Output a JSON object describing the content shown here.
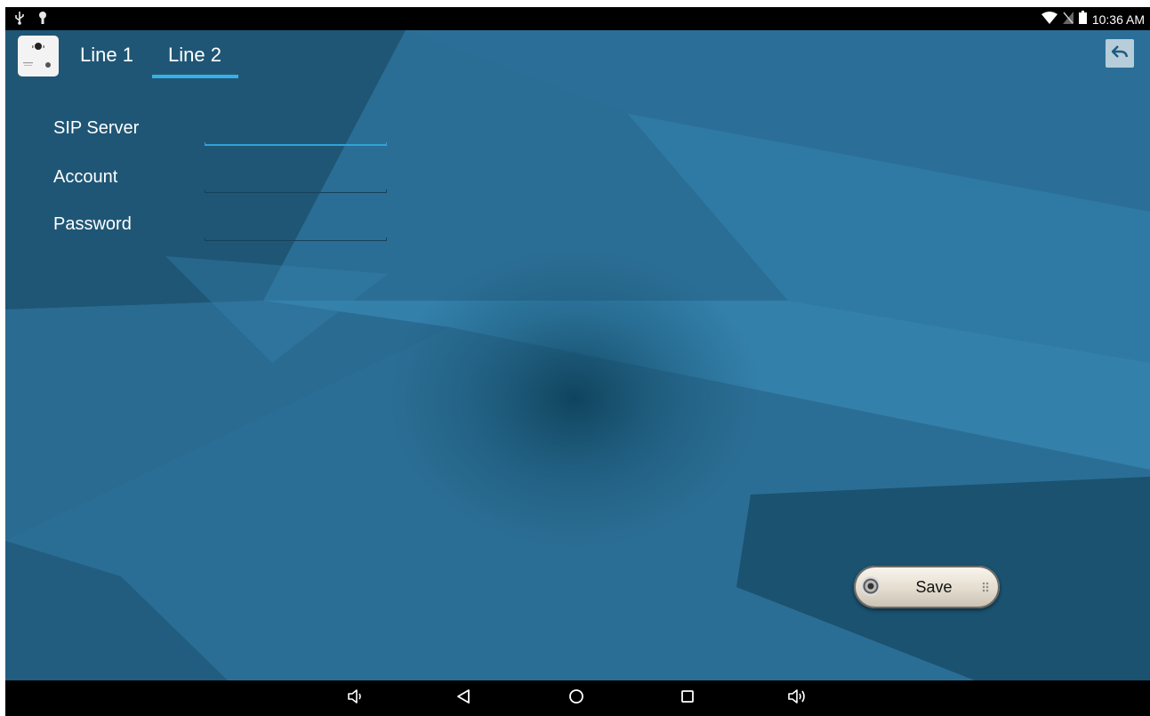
{
  "status_bar": {
    "left_icons": [
      "usb-icon",
      "debug-icon"
    ],
    "right_icons": [
      "wifi-icon",
      "no-sim-icon",
      "battery-icon"
    ],
    "time": "10:36 AM"
  },
  "app_bar": {
    "logo_icon": "doorbell-app-icon",
    "tabs": [
      {
        "label": "Line 1",
        "selected": false
      },
      {
        "label": "Line 2",
        "selected": true
      }
    ],
    "back_icon": "reply-back-icon"
  },
  "form": {
    "fields": [
      {
        "label": "SIP Server",
        "value": "",
        "placeholder": "",
        "focused": true
      },
      {
        "label": "Account",
        "value": "",
        "placeholder": "",
        "focused": false
      },
      {
        "label": "Password",
        "value": "",
        "placeholder": "",
        "focused": false
      }
    ]
  },
  "save_button": {
    "label": "Save",
    "icon": "speaker-grille-icon"
  },
  "nav_bar": {
    "buttons": [
      "volume-down-icon",
      "back-icon",
      "home-icon",
      "recents-icon",
      "volume-up-icon"
    ]
  },
  "colors": {
    "background": "#2a6c93",
    "tab_indicator": "#3aaee6",
    "focused_underline": "#2ea3d8",
    "status_bar": "#000000"
  }
}
